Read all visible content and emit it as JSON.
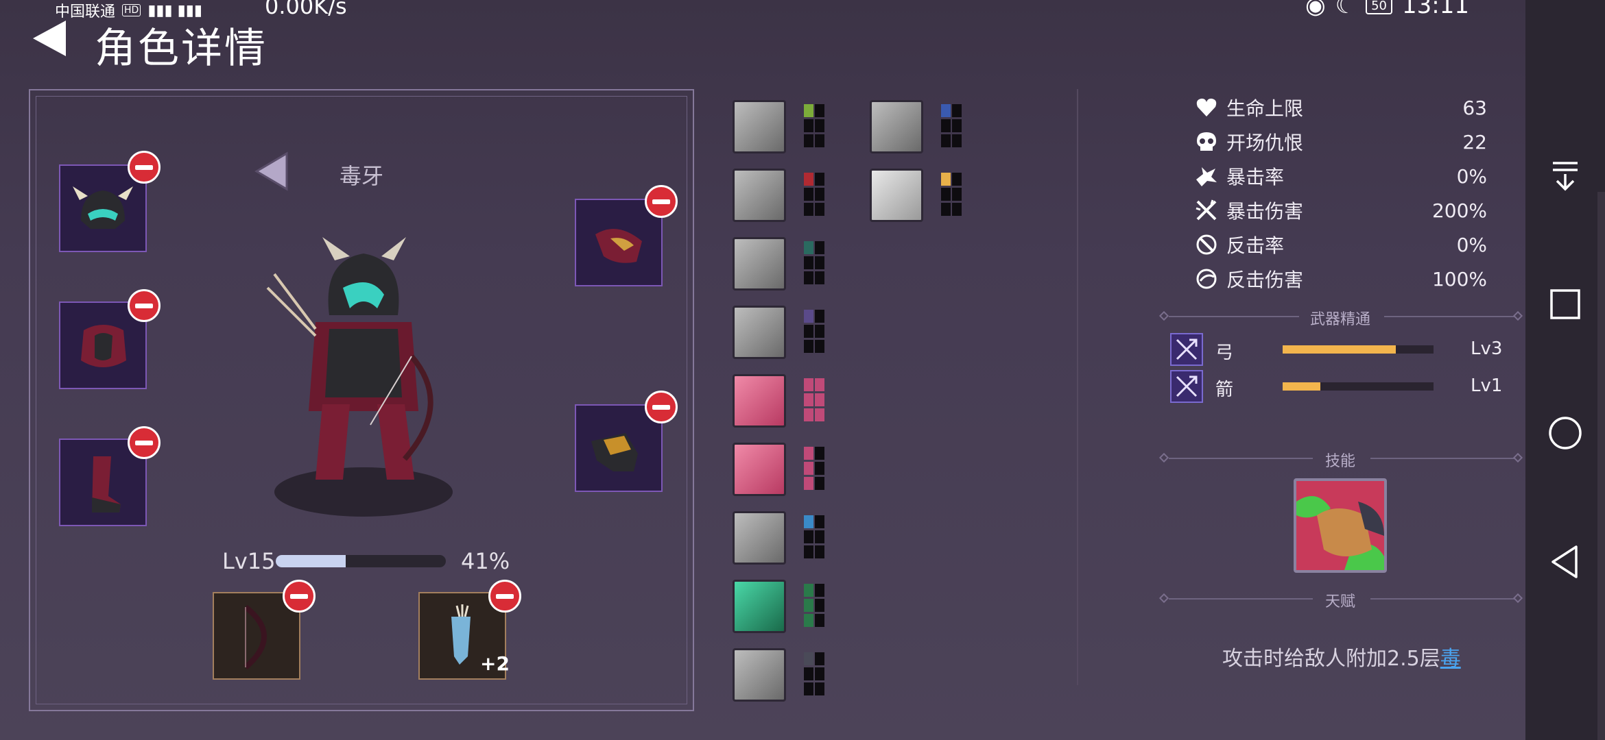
{
  "status_bar": {
    "carrier": "中国联通",
    "hd": "HD",
    "speed": "0.00K/s",
    "battery": "50",
    "time": "13:11"
  },
  "header": {
    "title": "角色详情"
  },
  "character": {
    "name": "毒牙",
    "level_label": "Lv15",
    "xp_percent": "41%",
    "xp_fraction": 0.41
  },
  "equipment": {
    "arrow_bonus": "+2"
  },
  "buffs": {
    "col1": [
      {
        "name": "strength-buff-icon",
        "pips": [
          1,
          0,
          0,
          0,
          0,
          0
        ],
        "color": "#7cac3a",
        "style": "gray"
      },
      {
        "name": "target-buff-icon",
        "pips": [
          1,
          0,
          0,
          0,
          0,
          0
        ],
        "color": "#b02a32",
        "style": "gray"
      },
      {
        "name": "blade-buff-icon",
        "pips": [
          1,
          0,
          0,
          0,
          0,
          0
        ],
        "color": "#2a6a60",
        "style": "gray"
      },
      {
        "name": "axe-buff-icon",
        "pips": [
          1,
          0,
          0,
          0,
          0,
          0
        ],
        "color": "#5a4a8a",
        "style": "gray"
      },
      {
        "name": "claw-slash-buff-icon",
        "pips": [
          1,
          1,
          1,
          1,
          1,
          1
        ],
        "color": "#c04a78",
        "style": "pink"
      },
      {
        "name": "cross-slash-buff-icon",
        "pips": [
          1,
          0,
          1,
          0,
          1,
          0
        ],
        "color": "#c04a78",
        "style": "pink"
      },
      {
        "name": "knight-buff-icon",
        "pips": [
          1,
          0,
          0,
          0,
          0,
          0
        ],
        "color": "#3a8ac8",
        "style": "gray"
      },
      {
        "name": "poison-buff-icon",
        "pips": [
          1,
          0,
          1,
          0,
          1,
          0
        ],
        "color": "#2a7a4a",
        "style": "green"
      },
      {
        "name": "lightning-buff-icon",
        "pips": [
          1,
          0,
          0,
          0,
          0,
          0
        ],
        "color": "#4a4a58",
        "style": "gray"
      }
    ],
    "col2": [
      {
        "name": "group-buff-icon",
        "pips": [
          1,
          0,
          0,
          0,
          0,
          0
        ],
        "color": "#3a5ab0",
        "style": "gray"
      },
      {
        "name": "hand-magic-buff-icon",
        "pips": [
          1,
          0,
          0,
          0,
          0,
          0
        ],
        "color": "#e8b04a",
        "style": "light"
      }
    ]
  },
  "stats": [
    {
      "icon": "heart-icon",
      "label": "生命上限",
      "value": "63"
    },
    {
      "icon": "skull-icon",
      "label": "开场仇恨",
      "value": "22"
    },
    {
      "icon": "crit-rate-icon",
      "label": "暴击率",
      "value": "0%"
    },
    {
      "icon": "crit-damage-icon",
      "label": "暴击伤害",
      "value": "200%"
    },
    {
      "icon": "counter-rate-icon",
      "label": "反击率",
      "value": "0%"
    },
    {
      "icon": "counter-damage-icon",
      "label": "反击伤害",
      "value": "100%"
    }
  ],
  "sections": {
    "weapon_mastery": "武器精通",
    "skills": "技能",
    "talent": "天赋"
  },
  "mastery": [
    {
      "label": "弓",
      "level": "Lv3",
      "progress": 0.75
    },
    {
      "label": "箭",
      "level": "Lv1",
      "progress": 0.25
    }
  ],
  "talent": {
    "text": "攻击时给敌人附加2.5层",
    "highlight": "毒"
  },
  "colors": {
    "accent_gold": "#f3b54d",
    "remove_red": "#d82c36",
    "talent_link": "#4aa4f0"
  }
}
